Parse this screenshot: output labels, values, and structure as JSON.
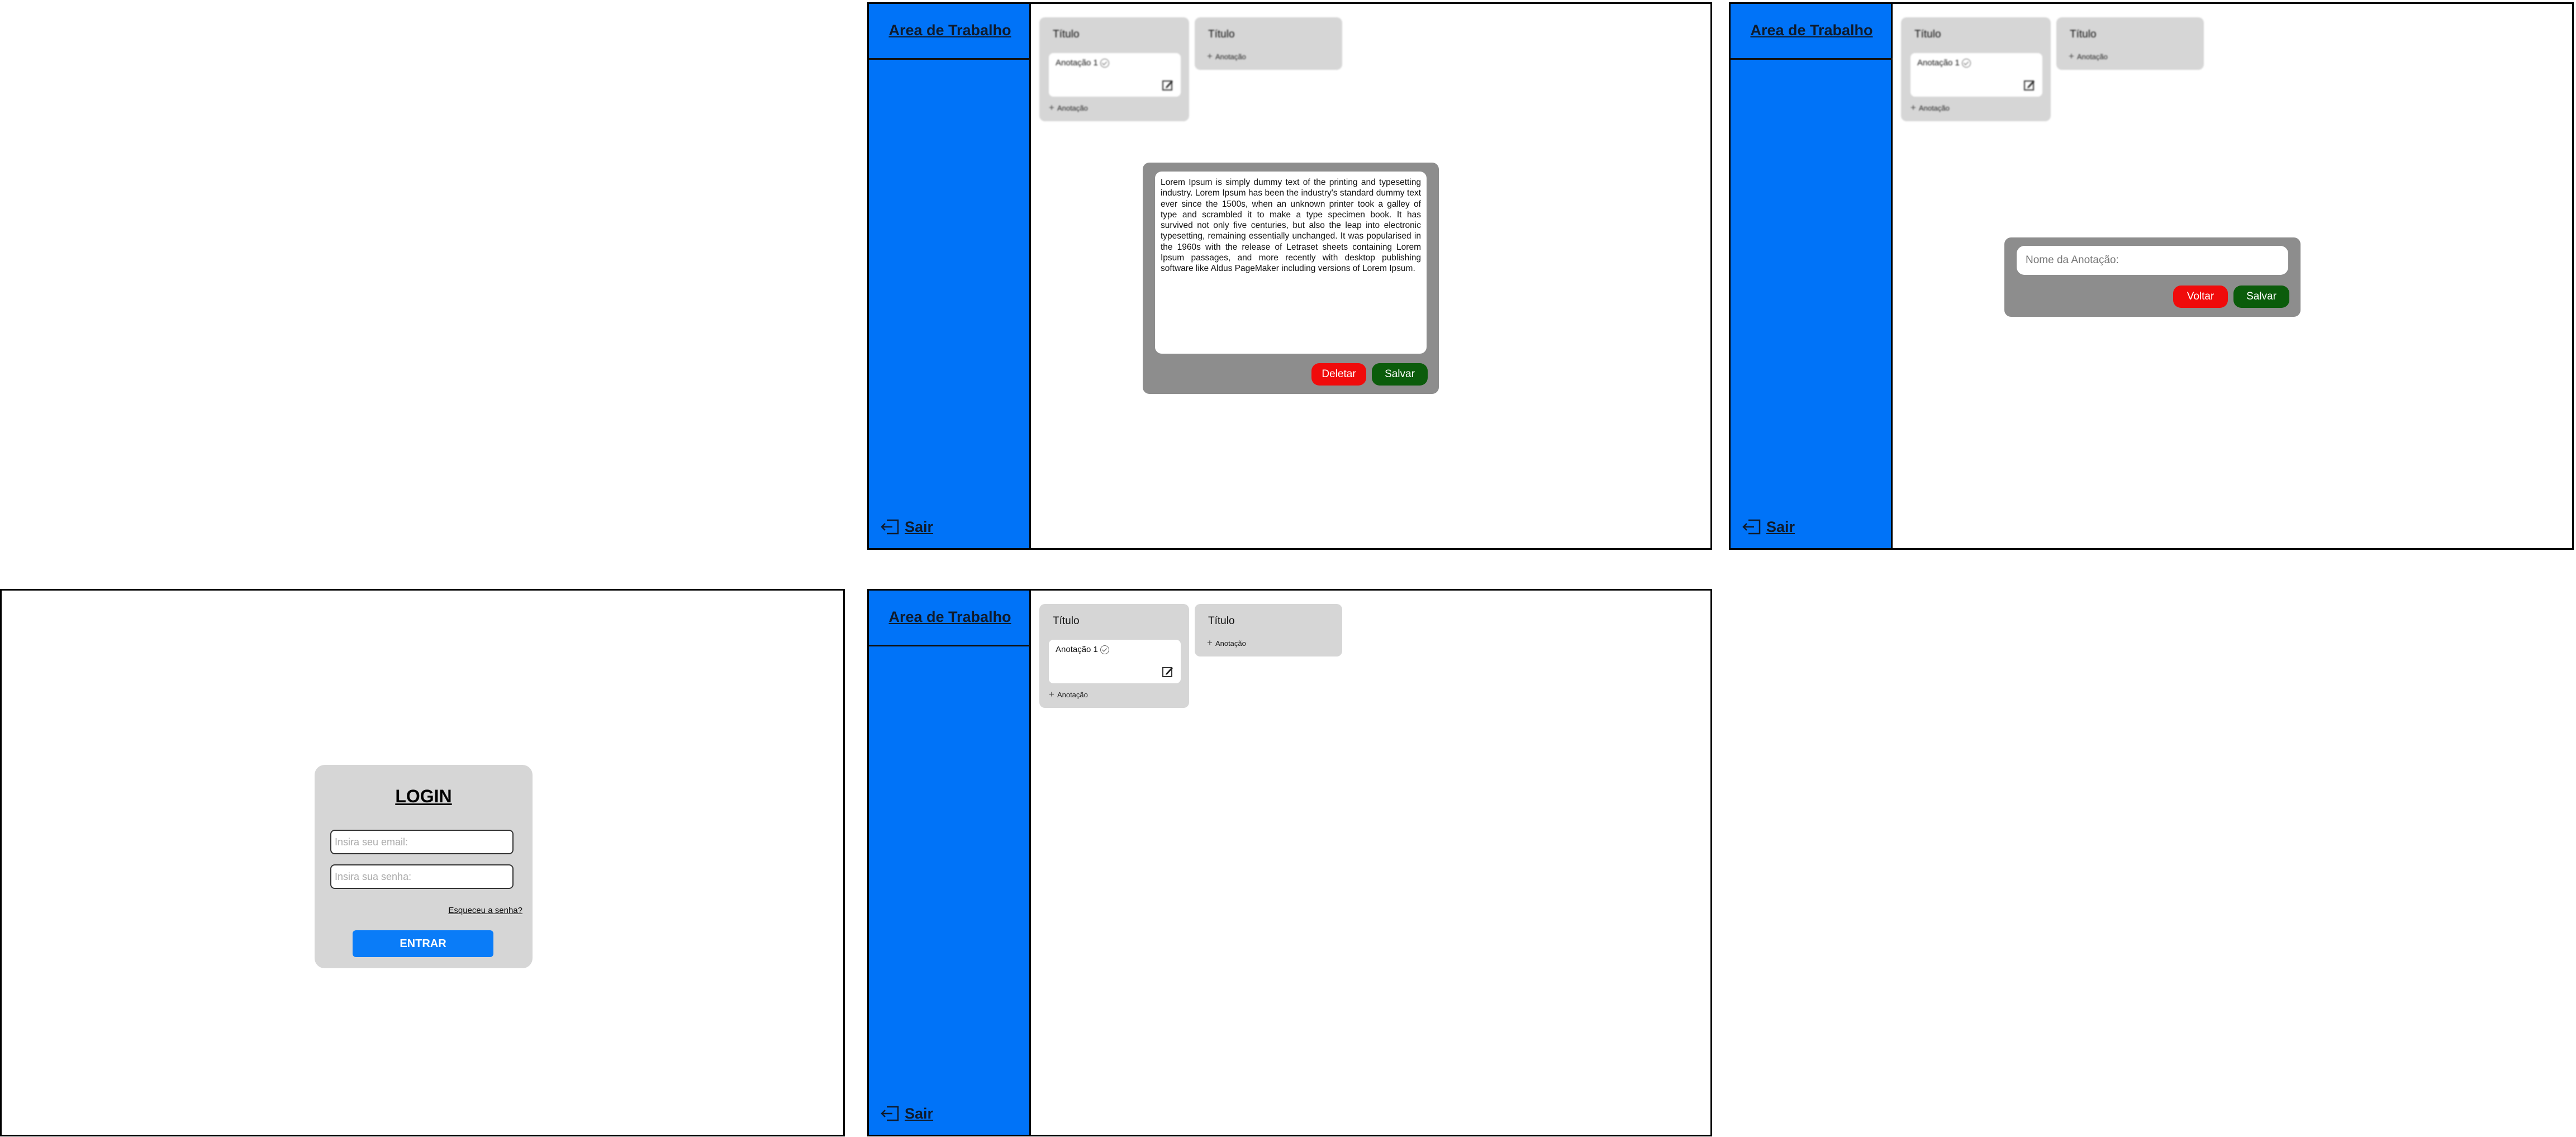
{
  "workspace": {
    "sidebar_title": "Area de Trabalho",
    "logout_label": "Sair",
    "columns": [
      {
        "title": "Título",
        "cards": [
          {
            "text": "Anotação 1"
          }
        ],
        "add_label": "Anotação"
      },
      {
        "title": "Título",
        "cards": [],
        "add_label": "Anotação"
      }
    ]
  },
  "note_modal": {
    "text": "Lorem Ipsum is simply dummy text of the printing and typesetting industry. Lorem Ipsum has been the industry's standard dummy text ever since the 1500s, when an unknown printer took a galley of type and scrambled it to make a type specimen book. It has survived not only five centuries, but also the leap into electronic typesetting, remaining essentially unchanged. It was popularised in the 1960s with the release of Letraset sheets containing Lorem Ipsum passages, and more recently with desktop publishing software like Aldus PageMaker including versions of Lorem Ipsum.",
    "delete_label": "Deletar",
    "save_label": "Salvar"
  },
  "new_note_modal": {
    "placeholder": "Nome da Anotação:",
    "back_label": "Voltar",
    "save_label": "Salvar"
  },
  "login": {
    "title": "LOGIN",
    "email_placeholder": "Insira seu email:",
    "password_placeholder": "Insira sua senha:",
    "forgot_label": "Esqueceu a senha?",
    "submit_label": "ENTRAR"
  },
  "colors": {
    "sidebar": "#0073f8",
    "column": "#d6d6d6",
    "modal": "#8d8d8d",
    "danger": "#f00b0b",
    "success": "#0b5c0b",
    "primary": "#0a7cf8"
  }
}
